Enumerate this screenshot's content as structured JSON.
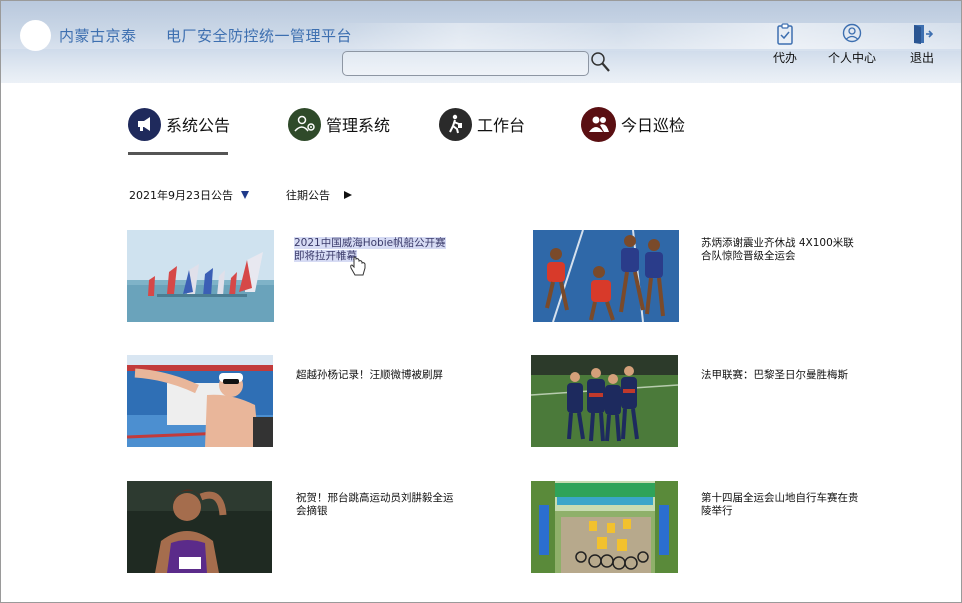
{
  "header": {
    "brand": "内蒙古京泰",
    "platform": "电厂安全防控统一管理平台",
    "search": {
      "value": "",
      "placeholder": ""
    },
    "buttons": [
      {
        "label": "代办",
        "icon": "clipboard-icon"
      },
      {
        "label": "个人中心",
        "icon": "user-icon"
      },
      {
        "label": "退出",
        "icon": "exit-door-icon"
      }
    ]
  },
  "nav": {
    "items": [
      {
        "label": "系统公告",
        "icon": "megaphone-icon",
        "color": "#1f2a5c",
        "active": true
      },
      {
        "label": "管理系统",
        "icon": "people-gear-icon",
        "color": "#2f4a2a"
      },
      {
        "label": "工作台",
        "icon": "worker-icon",
        "color": "#2a2a2a"
      },
      {
        "label": "今日巡检",
        "icon": "people-icon",
        "color": "#5a0f12"
      }
    ]
  },
  "announcement": {
    "date_label": "2021年9月23日公告",
    "past_label": "往期公告"
  },
  "news": [
    {
      "title": "2021中国威海Hobie帆船公开赛即将拉开帷幕",
      "image": "sailing-image"
    },
    {
      "title": "苏炳添谢震业齐休战 4X100米联合队惊险晋级全运会",
      "image": "relay-image"
    },
    {
      "title": "超越孙杨记录！汪顺微博被刷屏",
      "image": "swimmer-image"
    },
    {
      "title": "法甲联赛：巴黎圣日尔曼胜梅斯",
      "image": "football-image"
    },
    {
      "title": "祝贺！邢台跳高运动员刘肼毅全运会摘银",
      "image": "high-jump-image"
    },
    {
      "title": "第十四届全运会山地自行车赛在贵陵举行",
      "image": "cycling-image"
    }
  ],
  "colors": {
    "accent": "#3d6fb0",
    "nav_active_underline": "#555555"
  }
}
